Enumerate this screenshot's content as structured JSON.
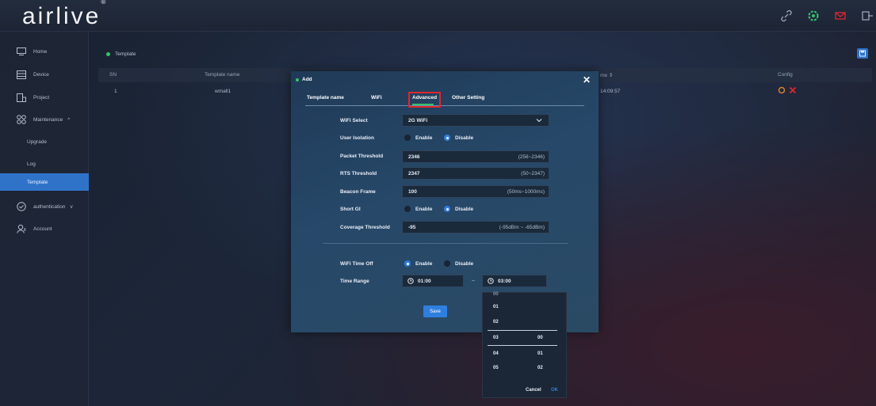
{
  "brand": {
    "logo": "airlive",
    "reg": "®"
  },
  "colors": {
    "accent": "#2f73c9",
    "success": "#36c46b",
    "danger": "#e0262e",
    "warning": "#d9822b"
  },
  "topbar": {
    "icons": [
      "link-icon",
      "settings-green-icon",
      "mail-icon",
      "logout-icon"
    ]
  },
  "sidebar": {
    "items": [
      {
        "label": "Home",
        "icon": "monitor-icon"
      },
      {
        "label": "Device",
        "icon": "device-list-icon"
      },
      {
        "label": "Project",
        "icon": "project-icon"
      },
      {
        "label": "Maintenance",
        "icon": "maintenance-icon",
        "chevron": "^"
      },
      {
        "label": "Upgrade"
      },
      {
        "label": "Log"
      },
      {
        "label": "Template",
        "active": true
      },
      {
        "label": "authentication",
        "icon": "shield-icon",
        "chevron": "v"
      },
      {
        "label": "Account",
        "icon": "account-icon"
      }
    ]
  },
  "page": {
    "breadcrumb": "Template",
    "table": {
      "headers": {
        "sn": "SN",
        "name": "Template name",
        "time": "me ⇕",
        "config": "Config"
      },
      "rows": [
        {
          "sn": "1",
          "name": "wmall1",
          "time": "14:09:57"
        }
      ]
    }
  },
  "modal": {
    "title": "Add",
    "close": "✕",
    "tabs": [
      "Template name",
      "WiFi",
      "Advanced",
      "Other Setting"
    ],
    "active_tab": "Advanced",
    "fields": {
      "wifi_select": {
        "label": "WiFi Select",
        "value": "2G WiFi"
      },
      "user_isolation": {
        "label": "User Isolation",
        "enable": "Enable",
        "disable": "Disable",
        "selected": "Disable"
      },
      "packet_threshold": {
        "label": "Packet Threshold",
        "value": "2346",
        "hint": "(256~2346)"
      },
      "rts_threshold": {
        "label": "RTS Threshold",
        "value": "2347",
        "hint": "(50~2347)"
      },
      "beacon_frame": {
        "label": "Beacon Frame",
        "value": "100",
        "hint": "(50ms~1000ms)"
      },
      "short_gi": {
        "label": "Short GI",
        "enable": "Enable",
        "disable": "Disable",
        "selected": "Disable"
      },
      "coverage_threshold": {
        "label": "Coverage Threshold",
        "value": "-95",
        "hint": "(-95dBm ~ -65dBm)"
      },
      "wifi_time_off": {
        "label": "WiFi Time Off",
        "enable": "Enable",
        "disable": "Disable",
        "selected": "Enable"
      },
      "time_range": {
        "label": "Time Range",
        "start": "01:00",
        "separator": "–",
        "end": "03:00"
      }
    },
    "save_label": "Save"
  },
  "time_picker": {
    "hours": [
      "01",
      "02",
      "03",
      "04",
      "05"
    ],
    "minutes": [
      "00",
      "01",
      "02"
    ],
    "selected_hour": "03",
    "selected_minute": "00",
    "cancel_label": "Cancel",
    "ok_label": "OK"
  }
}
